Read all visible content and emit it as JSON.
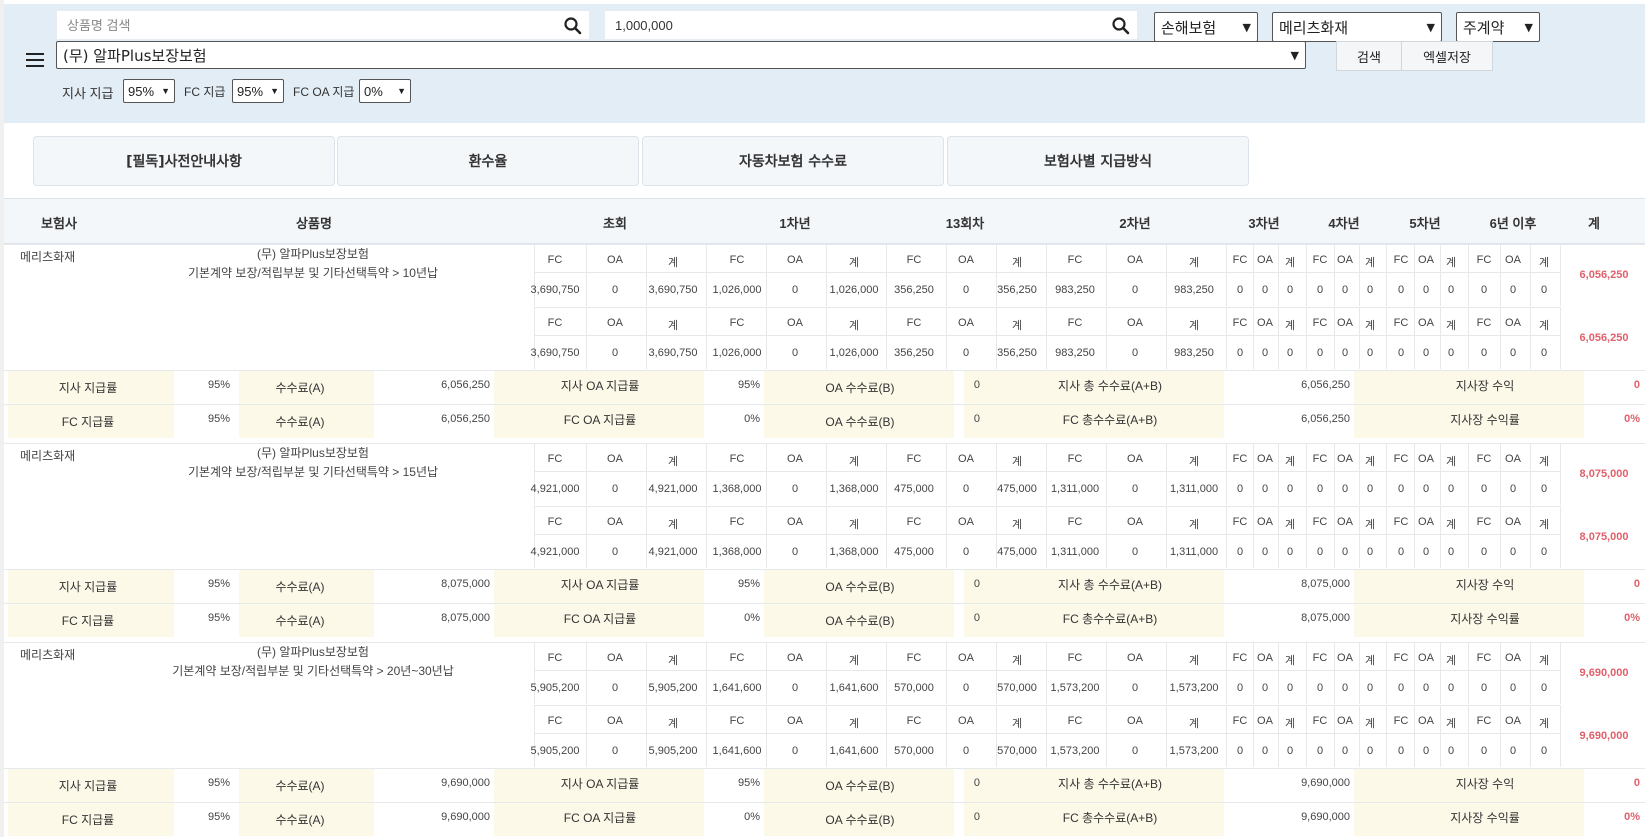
{
  "toolbar": {
    "search_placeholder": "상품명 검색",
    "amount_value": "1,000,000",
    "category_select": "손해보험",
    "company_select": "메리츠화재",
    "contract_select": "주계약",
    "product_select": "(무) 알파Plus보장보험",
    "search_button": "검색",
    "excel_button": "엑셀저장",
    "branch_label": "지사 지급",
    "branch_value": "95%",
    "fc_label": "FC 지급",
    "fc_value": "95%",
    "fcoa_label": "FC OA 지급",
    "fcoa_value": "0%"
  },
  "tabs": [
    "[필독]사전안내사항",
    "환수율",
    "자동차보험 수수료",
    "보험사별 지급방식"
  ],
  "columns": {
    "insurer": "보험사",
    "product": "상품명",
    "first": "초회",
    "year1": "1차년",
    "r13": "13회차",
    "year2": "2차년",
    "year3": "3차년",
    "year4": "4차년",
    "year5": "5차년",
    "year6": "6년 이후",
    "total": "계"
  },
  "sub_headers": {
    "fc": "FC",
    "oa": "OA",
    "sum": "계"
  },
  "summary_labels": {
    "branch_rate": "지사 지급률",
    "fc_rate": "FC 지급률",
    "fee_a": "수수료(A)",
    "branch_oa_rate": "지사 OA 지급률",
    "fc_oa_rate": "FC OA 지급률",
    "oa_fee_b": "OA 수수료(B)",
    "branch_total_fee": "지사 총 수수료(A+B)",
    "fc_total_fee": "FC 총수수료(A+B)",
    "manager_income": "지사장 수익",
    "manager_income_rate": "지사장 수익률"
  },
  "products": [
    {
      "insurer": "메리츠화재",
      "name": "(무) 알파Plus보장보험",
      "desc": "기본계약 보장/적립부분 및 기타선택특약 > 10년납",
      "first": "3,690,750",
      "year1": "1,026,000",
      "r13": "356,250",
      "year2": "983,250",
      "total": "6,056,250",
      "branch_rate": "95%",
      "fc_rate": "95%",
      "fee_a": "6,056,250",
      "branch_oa_rate": "95%",
      "fc_oa_rate": "0%",
      "oa_fee": "0",
      "total_fee": "6,056,250",
      "income": "0",
      "income_rate": "0%"
    },
    {
      "insurer": "메리츠화재",
      "name": "(무) 알파Plus보장보험",
      "desc": "기본계약 보장/적립부분 및 기타선택특약 > 15년납",
      "first": "4,921,000",
      "year1": "1,368,000",
      "r13": "475,000",
      "year2": "1,311,000",
      "total": "8,075,000",
      "branch_rate": "95%",
      "fc_rate": "95%",
      "fee_a": "8,075,000",
      "branch_oa_rate": "95%",
      "fc_oa_rate": "0%",
      "oa_fee": "0",
      "total_fee": "8,075,000",
      "income": "0",
      "income_rate": "0%"
    },
    {
      "insurer": "메리츠화재",
      "name": "(무) 알파Plus보장보험",
      "desc": "기본계약 보장/적립부분 및 기타선택특약 > 20년~30년납",
      "first": "5,905,200",
      "year1": "1,641,600",
      "r13": "570,000",
      "year2": "1,573,200",
      "total": "9,690,000",
      "branch_rate": "95%",
      "fc_rate": "95%",
      "fee_a": "9,690,000",
      "branch_oa_rate": "95%",
      "fc_oa_rate": "0%",
      "oa_fee": "0",
      "total_fee": "9,690,000",
      "income": "0",
      "income_rate": "0%"
    }
  ],
  "zero": "0"
}
